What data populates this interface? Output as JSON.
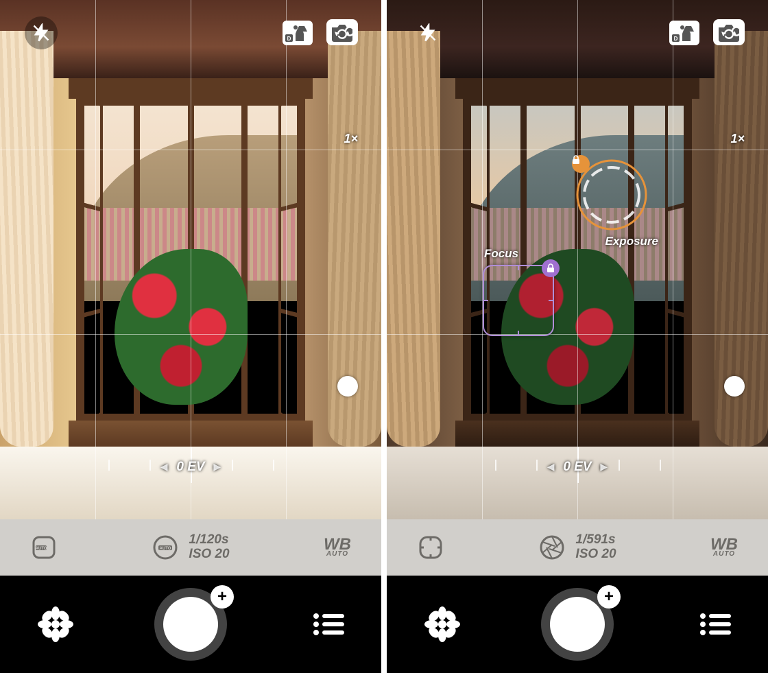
{
  "screens": {
    "a": {
      "zoom": "1×",
      "ev_label": "0 EV",
      "focus_mode_auto": true,
      "aperture_auto": true,
      "shutter": "1/120s",
      "iso": "ISO 20",
      "wb_label": "WB",
      "wb_sub": "AUTO",
      "shutter_plus": "+"
    },
    "b": {
      "zoom": "1×",
      "ev_label": "0 EV",
      "focus_mode_auto": false,
      "aperture_auto": false,
      "shutter": "1/591s",
      "iso": "ISO 20",
      "wb_label": "WB",
      "wb_sub": "AUTO",
      "focus_label": "Focus",
      "exposure_label": "Exposure",
      "shutter_plus": "+"
    }
  },
  "colors": {
    "focus_ring": "#b08ed8",
    "focus_lock": "#a070d0",
    "exposure_ring": "#e6933a"
  }
}
